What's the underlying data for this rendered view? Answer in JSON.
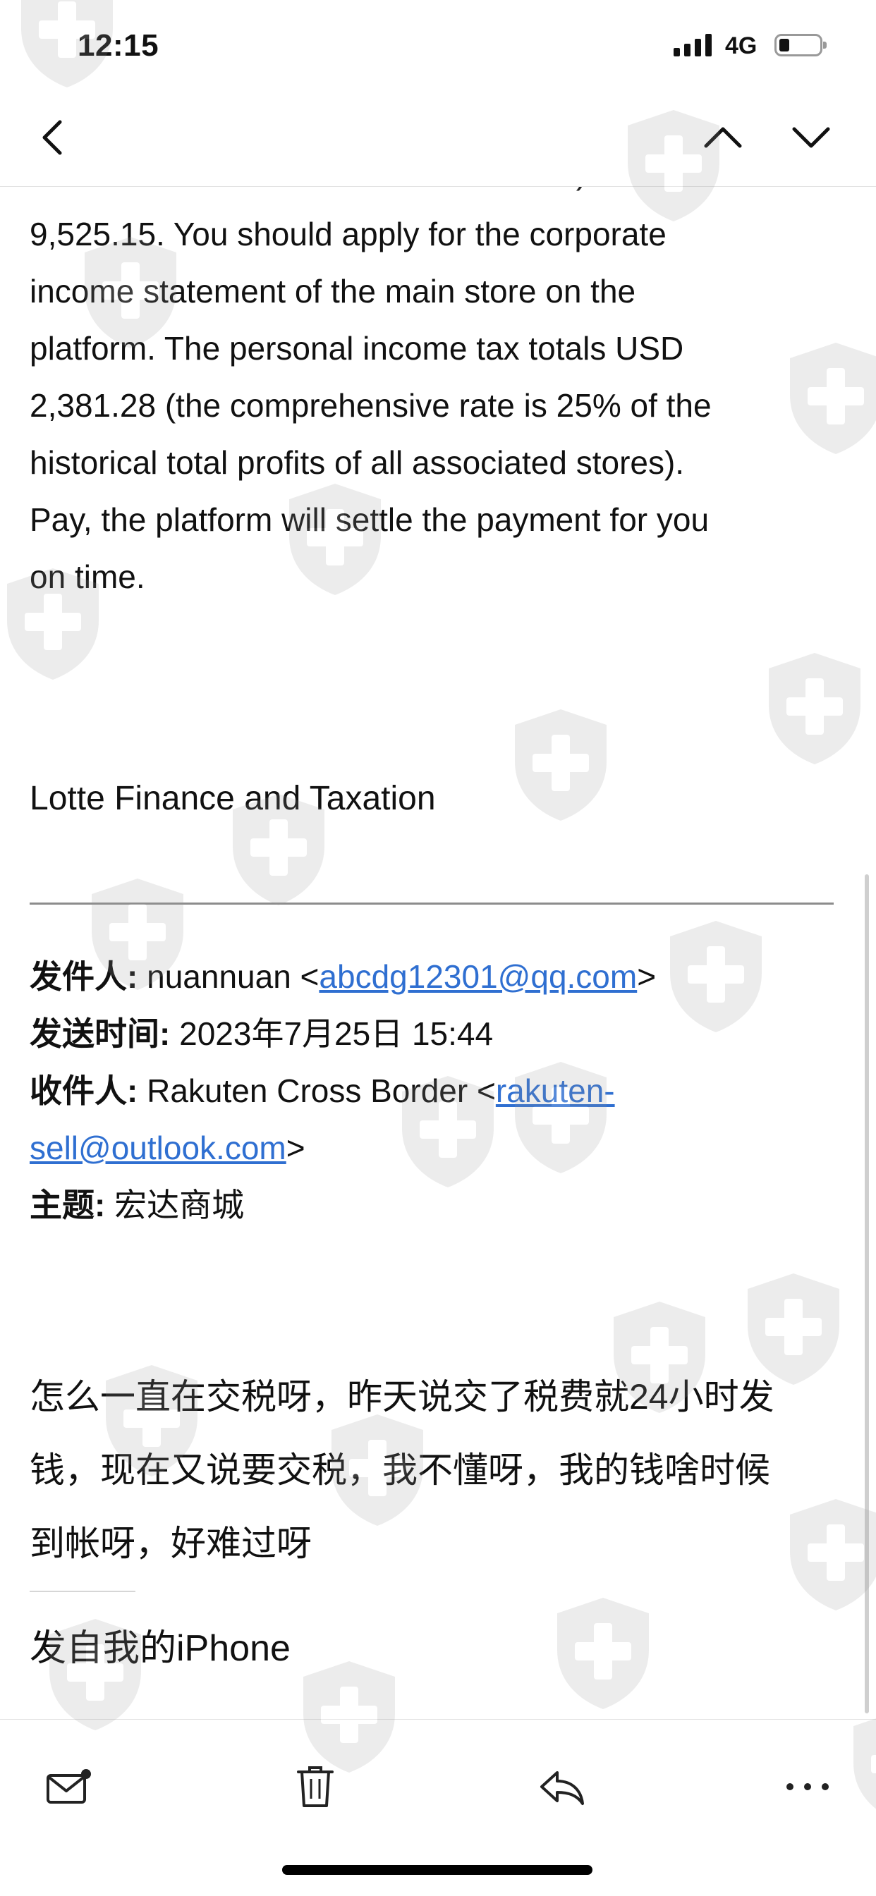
{
  "status_bar": {
    "time": "12:15",
    "network": "4G"
  },
  "nav": {
    "back_icon": "chevron-left-icon",
    "prev_icon": "chevron-up-icon",
    "next_icon": "chevron-down-icon"
  },
  "email": {
    "partial_line": "turnover of the store - total investment) USD",
    "body_lines": [
      "9,525.15. You should apply for the corporate",
      "income statement of the main store on the",
      "platform. The personal income tax totals USD",
      "2,381.28 (the comprehensive rate is 25% of the",
      "historical total profits of all associated stores).",
      "Pay, the platform will settle the payment for you",
      "on time."
    ],
    "signature": "Lotte Finance and Taxation",
    "quoted_header": {
      "from_label": "发件人:",
      "from_name": "nuannuan <",
      "from_email": "abcdg12301@qq.com",
      "from_close": ">",
      "sent_label": "发送时间:",
      "sent_value": "2023年7月25日 15:44",
      "to_label": "收件人:",
      "to_name": "Rakuten Cross Border <",
      "to_email_line1": "rakuten-",
      "to_email_line2": "sell@outlook.com",
      "to_close": ">",
      "subject_label": "主题:",
      "subject_value": "宏达商城"
    },
    "reply_body_lines": [
      "怎么一直在交税呀，昨天说交了税费就24小时发",
      "钱，现在又说要交税，我不懂呀，我的钱啥时候",
      "到帐呀，好难过呀"
    ],
    "sent_from": "发自我的iPhone"
  },
  "toolbar": {
    "items": [
      {
        "name": "mark-unread",
        "icon": "envelope-dot-icon"
      },
      {
        "name": "delete",
        "icon": "trash-icon"
      },
      {
        "name": "reply",
        "icon": "reply-icon"
      },
      {
        "name": "more",
        "icon": "ellipsis-icon"
      }
    ]
  },
  "watermark": {
    "icon": "shield-cross-icon",
    "color": "#9a9a9a"
  }
}
